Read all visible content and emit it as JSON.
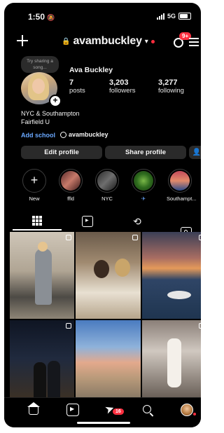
{
  "status_bar": {
    "time": "1:50",
    "network": "5G",
    "bell_icon": "bell-silenced-icon"
  },
  "header": {
    "username": "avambuckley",
    "notification_badge": "9+",
    "icons": [
      "plus-icon",
      "lock-icon",
      "chevron-down-icon",
      "threads-icon",
      "menu-icon"
    ]
  },
  "profile": {
    "note_text": "Try sharing a song...",
    "full_name": "Ava Buckley",
    "stats": [
      {
        "count": "7",
        "label": "posts"
      },
      {
        "count": "3,203",
        "label": "followers"
      },
      {
        "count": "3,277",
        "label": "following"
      }
    ],
    "bio_line1": "NYC & Southampton",
    "bio_line2": "Fairfield U",
    "add_school": "Add school",
    "threads_handle": "avambuckley"
  },
  "buttons": {
    "edit_profile": "Edit profile",
    "share_profile": "Share profile"
  },
  "highlights": [
    {
      "label": "New"
    },
    {
      "label": "ffld"
    },
    {
      "label": "NYC"
    },
    {
      "label": "✈"
    },
    {
      "label": "Southampt..."
    }
  ],
  "tabs": [
    "grid-icon",
    "reels-icon",
    "remix-icon",
    "tagged-icon"
  ],
  "bottom_nav": {
    "dm_badge": "16",
    "icons": [
      "home-icon",
      "reels-icon",
      "direct-message-icon",
      "search-icon",
      "profile-icon"
    ]
  },
  "colors": {
    "background": "#000000",
    "accent_blue": "#6aa8ff",
    "badge_red": "#ff3040",
    "button_gray": "#2a2a2a"
  }
}
